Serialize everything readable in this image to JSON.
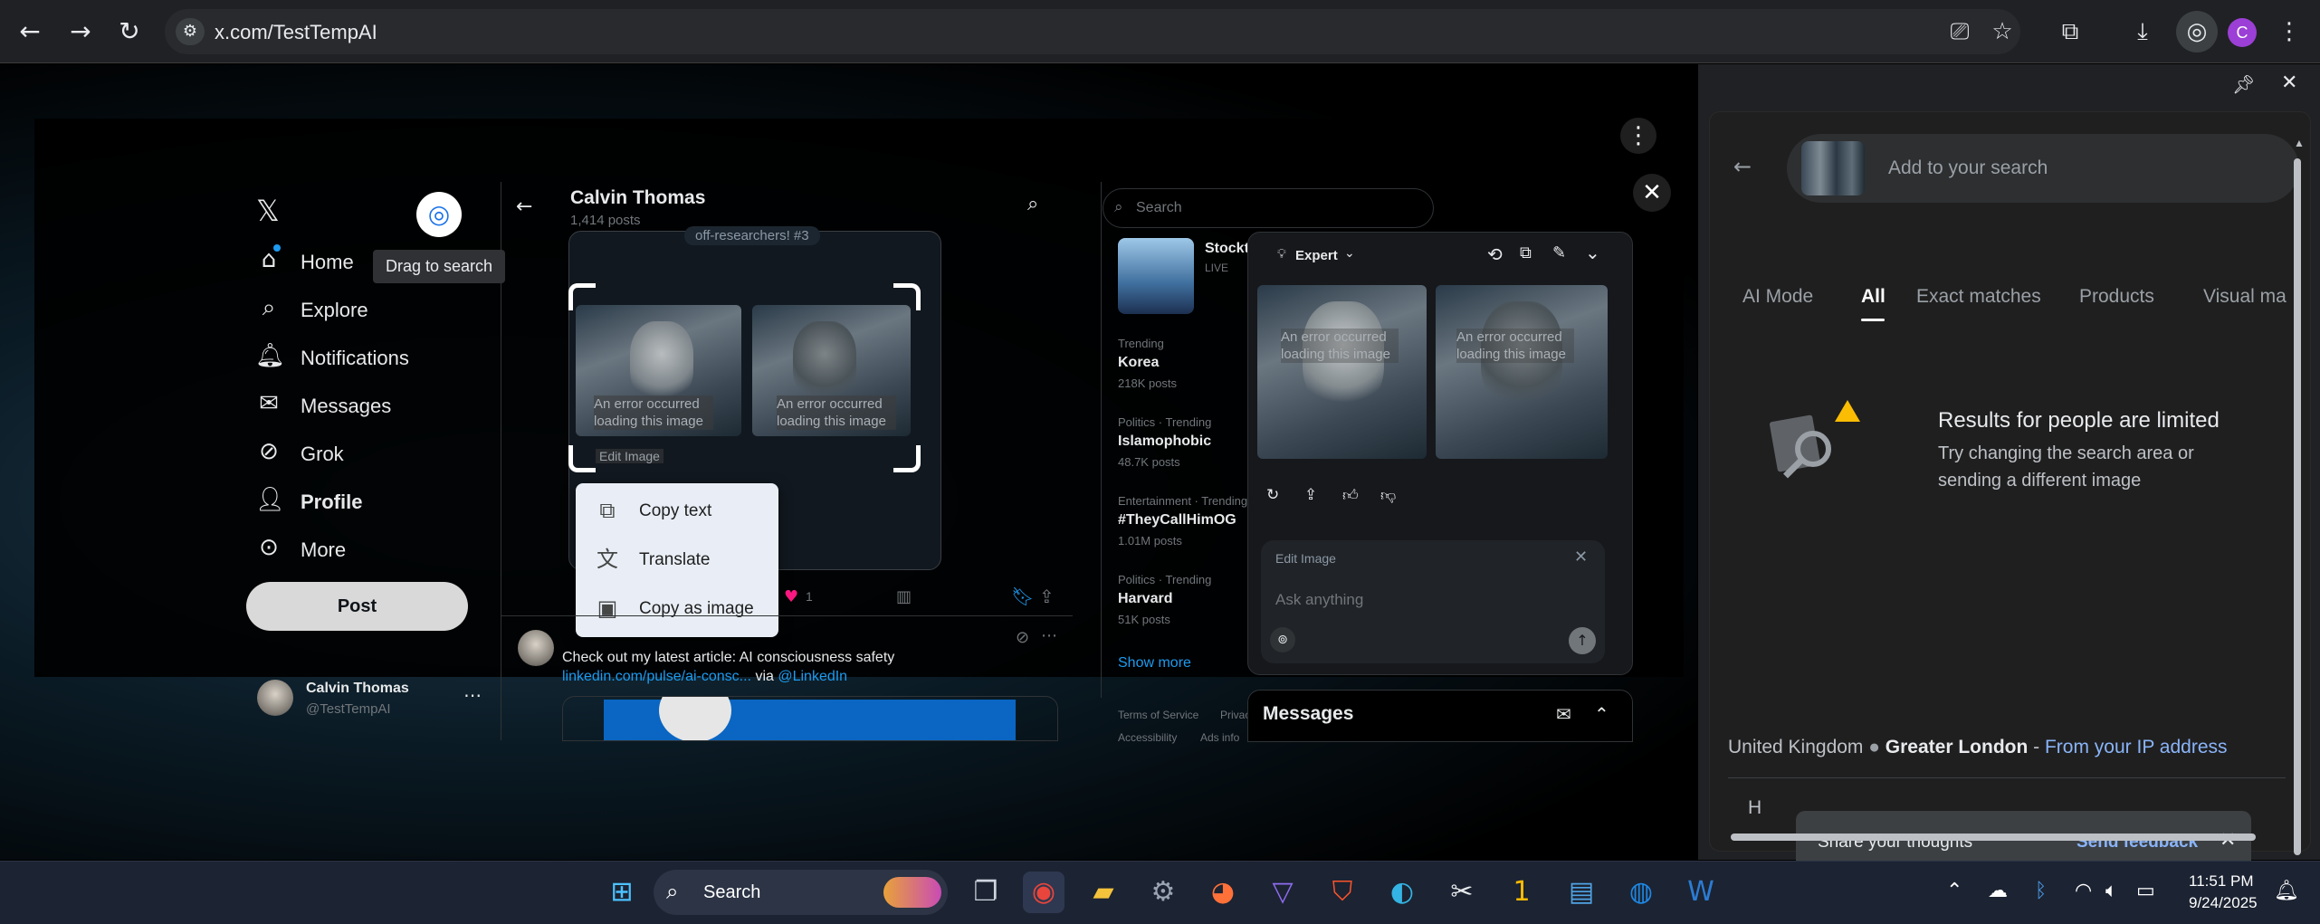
{
  "browser": {
    "url": "x.com/TestTempAI",
    "profile_initial": "C",
    "accent": "#9b3fd6"
  },
  "x_nav": {
    "tooltip": "Drag to search",
    "items": [
      {
        "label": "Home",
        "icon": "home-icon"
      },
      {
        "label": "Explore",
        "icon": "search-icon"
      },
      {
        "label": "Notifications",
        "icon": "bell-icon"
      },
      {
        "label": "Messages",
        "icon": "mail-icon"
      },
      {
        "label": "Grok",
        "icon": "grok-icon"
      },
      {
        "label": "Profile",
        "icon": "person-icon"
      },
      {
        "label": "More",
        "icon": "more-circle-icon"
      }
    ],
    "post_label": "Post",
    "user_name": "Calvin Thomas",
    "user_handle": "@TestTempAI"
  },
  "thread": {
    "title": "Calvin Thomas",
    "posts_count": "1,414 posts",
    "snippet": "off-researchers! #3",
    "error_text": "An error occurred loading this image",
    "edit_image": "Edit Image",
    "like_count": "1",
    "tweet_text": "Check out my latest article:  AI consciousness safety",
    "tweet_link": "linkedin.com/pulse/ai-consc...",
    "tweet_via": "via",
    "tweet_mention": "@LinkedIn"
  },
  "context_menu": {
    "items": [
      {
        "label": "Copy text",
        "icon": "copy-icon"
      },
      {
        "label": "Translate",
        "icon": "translate-icon"
      },
      {
        "label": "Copy as image",
        "icon": "image-icon"
      }
    ]
  },
  "sidebar_right": {
    "search_placeholder": "Search",
    "live_label": "Stockt",
    "live_badge": "LIVE",
    "trends": [
      {
        "category": "Trending",
        "name": "Korea",
        "count": "218K posts"
      },
      {
        "category": "Politics · Trending",
        "name": "Islamophobic",
        "count": "48.7K posts"
      },
      {
        "category": "Entertainment · Trending",
        "name": "#TheyCallHimOG",
        "count": "1.01M posts"
      },
      {
        "category": "Politics · Trending",
        "name": "Harvard",
        "count": "51K posts"
      }
    ],
    "show_more": "Show more",
    "footer_terms": "Terms of Service",
    "footer_priv": "Privac",
    "footer_access": "Accessibility",
    "footer_ads": "Ads info"
  },
  "grok": {
    "mode": "Expert",
    "input_title": "Edit Image",
    "input_placeholder": "Ask anything"
  },
  "messages": {
    "title": "Messages"
  },
  "lens": {
    "search_placeholder": "Add to your search",
    "tabs": [
      "AI Mode",
      "All",
      "Exact matches",
      "Products",
      "Visual ma"
    ],
    "active_tab": "All",
    "results_title": "Results for people are limited",
    "results_body": "Try changing the search area or sending a different image",
    "location_country": "United Kingdom",
    "location_region": "Greater London",
    "location_sep": " - ",
    "location_source": "From your IP address",
    "feedback_prompt": "Share your thoughts",
    "feedback_button": "Send feedback",
    "partial_h": "H"
  },
  "taskbar": {
    "search_label": "Search",
    "time": "11:51 PM",
    "date": "9/24/2025"
  }
}
